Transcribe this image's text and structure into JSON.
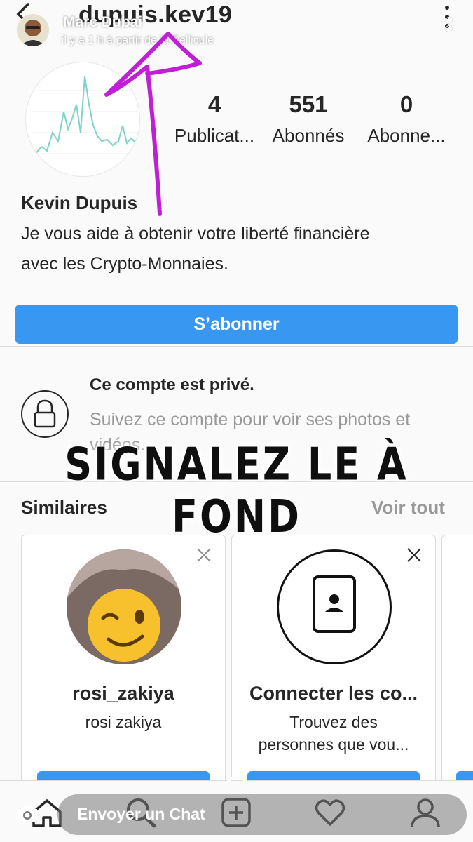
{
  "header": {
    "username": "dupuis.kev19"
  },
  "snap": {
    "sender_name": "Marc Dubai",
    "meta": "il y a 1 h à partir de la Pellicule",
    "reply_placeholder": "Envoyer un Chat",
    "overlay_caption": "SIGNALEZ LE À FOND"
  },
  "profile": {
    "stats": [
      {
        "value": "4",
        "label": "Publicat..."
      },
      {
        "value": "551",
        "label": "Abonnés"
      },
      {
        "value": "0",
        "label": "Abonne..."
      }
    ],
    "display_name": "Kevin Dupuis",
    "bio_line1": "Je vous aide à obtenir votre liberté financière",
    "bio_line2": "avec les Crypto-Monnaies.",
    "follow_label": "S’abonner"
  },
  "private": {
    "title": "Ce compte est privé.",
    "text": "Suivez ce compte pour voir ses photos et vidéos."
  },
  "similar": {
    "title": "Similaires",
    "see_all": "Voir tout",
    "cards": [
      {
        "name": "rosi_zakiya",
        "sub_line1": "rosi zakiya",
        "sub_line2": ""
      },
      {
        "name": "Connecter les co...",
        "sub_line1": "Trouvez des",
        "sub_line2": "personnes que vou..."
      }
    ]
  },
  "colors": {
    "accent": "#3897f0",
    "annotation": "#c11fd6"
  },
  "icons": [
    "back-arrow-icon",
    "kebab-icon",
    "lock-icon",
    "close-icon",
    "contact-card-icon",
    "home-icon",
    "search-icon",
    "add-icon",
    "heart-icon",
    "profile-icon",
    "camera-icon",
    "chevron-up-icon"
  ]
}
